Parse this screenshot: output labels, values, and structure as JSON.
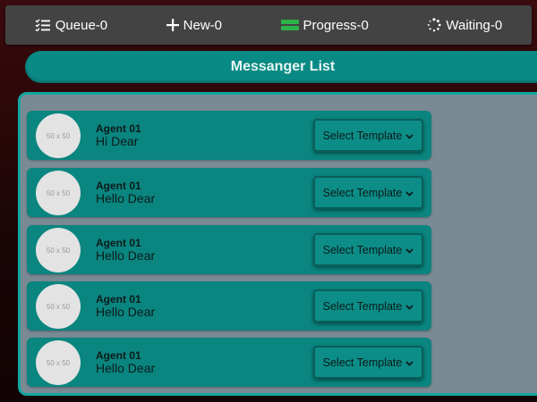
{
  "topbar": {
    "items": [
      {
        "label": "Queue-0",
        "icon": "checklist-icon"
      },
      {
        "label": "New-0",
        "icon": "plus-icon"
      },
      {
        "label": "Progress-0",
        "icon": "progress-bars-icon"
      },
      {
        "label": "Waiting-0",
        "icon": "spinner-icon"
      }
    ]
  },
  "title": "Messanger List",
  "colors": {
    "teal": "#0a857f",
    "panel": "#7a8a94",
    "progress_green": "#2bb34a"
  },
  "messages": [
    {
      "avatar": "50 x 50",
      "agent": "Agent 01",
      "text": "Hi Dear",
      "select": "Select Template"
    },
    {
      "avatar": "50 x 50",
      "agent": "Agent 01",
      "text": "Hello Dear",
      "select": "Select Template"
    },
    {
      "avatar": "50 x 50",
      "agent": "Agent 01",
      "text": "Hello Dear",
      "select": "Select Template"
    },
    {
      "avatar": "50 x 50",
      "agent": "Agent 01",
      "text": "Hello Dear",
      "select": "Select Template"
    },
    {
      "avatar": "50 x 50",
      "agent": "Agent 01",
      "text": "Hello Dear",
      "select": "Select Template"
    }
  ]
}
